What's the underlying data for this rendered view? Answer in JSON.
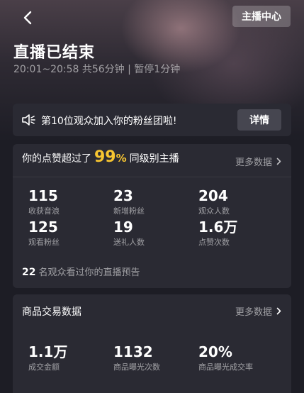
{
  "header": {
    "anchor_center_label": "主播中心",
    "title": "直播已结束",
    "subtitle": "20:01~20:58 共56分钟 | 暂停1分钟"
  },
  "notice": {
    "text": "第10位观众加入你的粉丝团啦!",
    "detail_label": "详情"
  },
  "stats": {
    "lead_prefix": "你的点赞超过了",
    "percent": "99",
    "percent_sign": "%",
    "lead_suffix": "同级别主播",
    "more_label": "更多数据",
    "items": [
      {
        "value": "115",
        "label": "收获音浪"
      },
      {
        "value": "23",
        "label": "新增粉丝"
      },
      {
        "value": "204",
        "label": "观众人数"
      },
      {
        "value": "125",
        "label": "观看粉丝"
      },
      {
        "value": "19",
        "label": "送礼人数"
      },
      {
        "value": "1.6万",
        "label": "点赞次数"
      }
    ],
    "preview_count": "22",
    "preview_text": "名观众看过你的直播预告"
  },
  "goods": {
    "title": "商品交易数据",
    "more_label": "更多数据",
    "items": [
      {
        "value": "1.1万",
        "label": "成交金额"
      },
      {
        "value": "1132",
        "label": "商品曝光次数"
      },
      {
        "value": "20%",
        "label": "商品曝光成交率"
      }
    ]
  },
  "colors": {
    "background": "#1d1d25",
    "card": "#2a2a33",
    "accent_yellow": "#f7c531"
  },
  "icons": {
    "back": "chevron-left-icon",
    "speaker": "speaker-icon",
    "more": "chevron-right-icon"
  }
}
